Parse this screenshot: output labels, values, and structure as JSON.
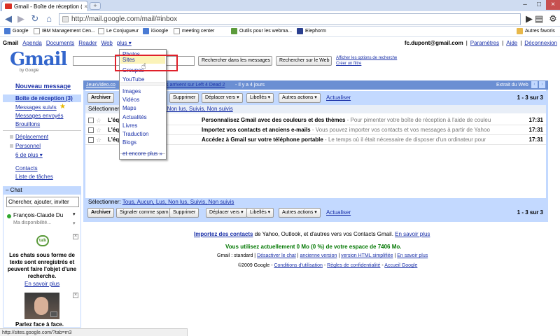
{
  "browser": {
    "tab_title": "Gmail - Boîte de réception (...",
    "url": "http://mail.google.com/mail/#inbox",
    "bookmarks": [
      "Google",
      "IBM Management Cen...",
      "Le Conjugueur",
      "iGoogle",
      "meeting center",
      "Outils pour les webma...",
      "Elephorm"
    ],
    "other_bookmarks": "Autres favoris",
    "status_url": "http://sites.google.com/?tab=m3"
  },
  "topnav": {
    "items": [
      "Gmail",
      "Agenda",
      "Documents",
      "Reader",
      "Web",
      "plus ▾"
    ],
    "email": "fc.dupont@gmail.com",
    "links": [
      "Paramètres",
      "Aide",
      "Déconnexion"
    ]
  },
  "search": {
    "btn_mail": "Rechercher dans les messages",
    "btn_web": "Rechercher sur le Web",
    "link_options": "Afficher les options de recherche",
    "link_filter": "Créer un filtre"
  },
  "logo": {
    "text": "Gmail",
    "by": "by Google"
  },
  "leftnav": {
    "compose": "Nouveau message",
    "items": [
      "Boîte de réception (3)",
      "Messages suivis",
      "Messages envoyés",
      "Brouillons"
    ],
    "labels": [
      "Déplacement",
      "Personnel",
      "6 de plus ▾"
    ],
    "contacts": "Contacts",
    "tasks": "Liste de tâches"
  },
  "chat": {
    "header": "Chat",
    "search_placeholder": "Chercher, ajouter, inviter",
    "user": "François-Claude Du",
    "status": "Ma disponibilité...",
    "promo_text": "Les chats sous forme de texte sont enregistrés et peuvent faire l'objet d'une recherche.",
    "promo_link": "En savoir plus",
    "talk_label": "talk",
    "video_text": "Parlez face à face."
  },
  "webclip": {
    "source": "JeuxVideo.co",
    "headline": "s arrivent sur Left 4 Dead 2",
    "time": "- Il y a 4 jours",
    "extract": "Extrait du Web"
  },
  "actions": {
    "archive": "Archiver",
    "spam": "Signaler comme spam",
    "delete": "Supprimer",
    "move": "Déplacer vers ▾",
    "labels": "Libellés ▾",
    "more": "Autres actions ▾",
    "refresh": "Actualiser",
    "count": "1 - 3 sur 3"
  },
  "select_row_top": {
    "prefix": "Sélectionner",
    "visible": ", Non lus, Suivis, Non suivis"
  },
  "select_row_bottom": {
    "prefix": "Sélectionner:",
    "items": "Tous, Aucun, Lus, Non lus, Suivis, Non suivis"
  },
  "emails": [
    {
      "sender": "L'éq",
      "subject": "Personnalisez Gmail avec des couleurs et des thèmes",
      "snippet": " - Pour pimenter votre boîte de réception à l'aide de couleu",
      "time": "17:31"
    },
    {
      "sender": "L'éq",
      "subject": "Importez vos contacts et anciens e-mails",
      "snippet": " - Vous pouvez importer vos contacts et vos messages à partir de Yahoo",
      "time": "17:31"
    },
    {
      "sender": "L'éq",
      "subject": "Accédez à Gmail sur votre téléphone portable",
      "snippet": " - Le temps où il était nécessaire de disposer d'un ordinateur pour",
      "time": "17:31"
    }
  ],
  "more_menu": {
    "items": [
      "Photos",
      "Sites",
      "Groupes",
      "YouTube",
      "Images",
      "Vidéos",
      "Maps",
      "Actualités",
      "Livres",
      "Traduction",
      "Blogs",
      "et encore plus »"
    ]
  },
  "footer": {
    "import_link": "Importez des contacts",
    "import_text": " de Yahoo, Outlook, et d'autres vers vos Contacts Gmail.",
    "learn_more": "En savoir plus",
    "usage": "Vous utilisez actuellement 0 Mo (0 %) de votre espace de 7406 Mo.",
    "view_prefix": "Gmail : standard |",
    "view_links": [
      "Désactiver le chat",
      "ancienne version",
      "version HTML simplifiée",
      "En savoir plus"
    ],
    "copyright": "©2009 Google -",
    "legal_links": [
      "Conditions d'utilisation",
      "Règles de confidentialité",
      "Accueil Google"
    ]
  },
  "colors": {
    "accent": "#c3d9ff",
    "link": "#1a30a8",
    "highlight": "#e0202a",
    "webclip": "#6b8fd3",
    "usage": "#007700"
  }
}
